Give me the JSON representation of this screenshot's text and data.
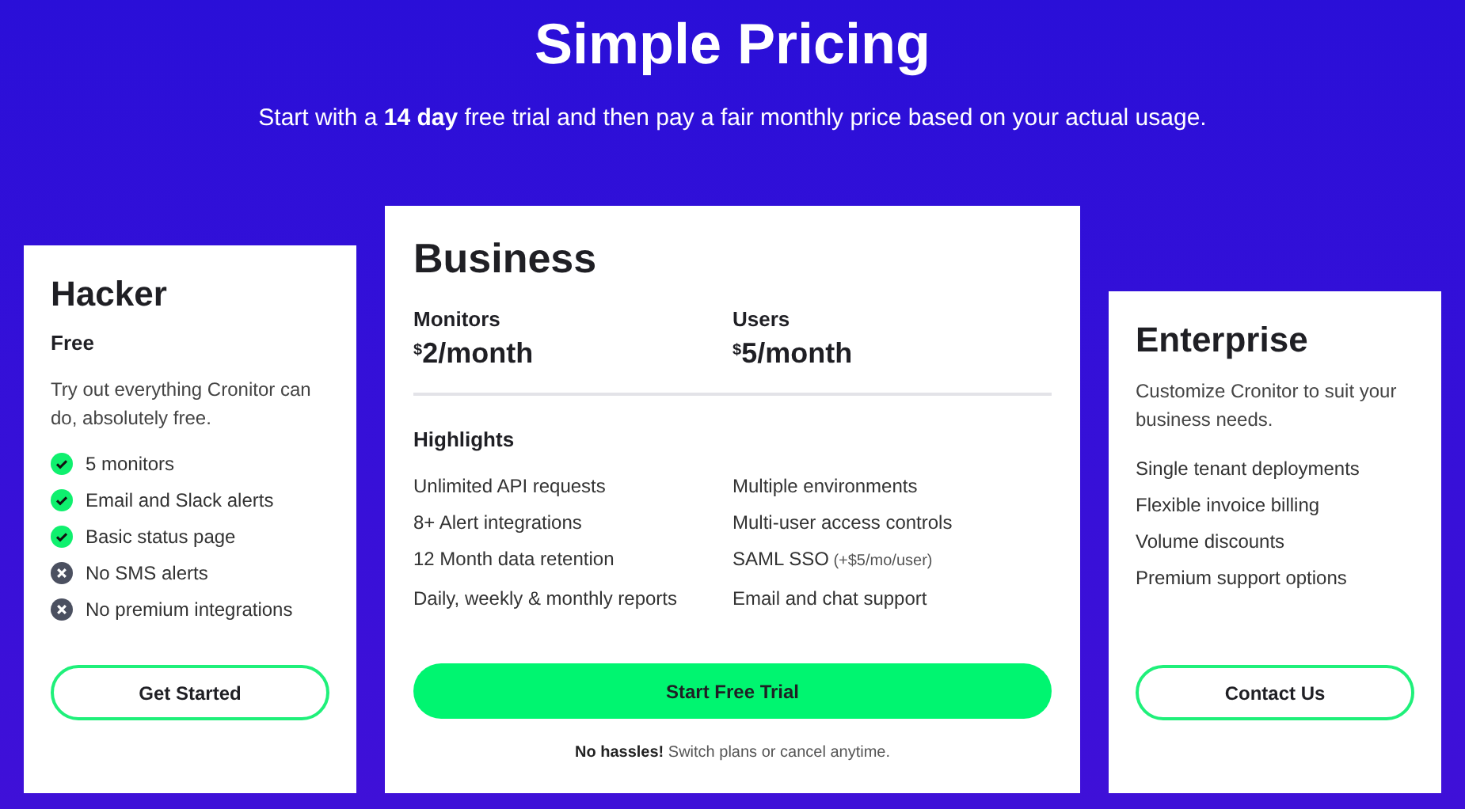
{
  "header": {
    "title": "Simple Pricing",
    "subtitle": "Start with a **14 day** free trial and then pay a fair monthly price based on your actual usage."
  },
  "plans": [
    {
      "name": "Hacker",
      "price": "Free",
      "description": "Try out everything Cronitor can do, absolutely free.",
      "features": [
        {
          "text": "5 monitors",
          "included": true
        },
        {
          "text": "Email and Slack alerts",
          "included": true
        },
        {
          "text": "Basic status page",
          "included": true
        },
        {
          "text": "No SMS alerts",
          "included": false
        },
        {
          "text": "No premium integrations",
          "included": false
        }
      ],
      "button": "Get Started"
    },
    {
      "name": "Business",
      "prices": [
        {
          "label": "Monitors",
          "currency": "$",
          "amount": "2/month"
        },
        {
          "label": "Users",
          "currency": "$",
          "amount": "5/month"
        }
      ],
      "highlights_title": "Highlights",
      "highlights": [
        {
          "text": "Unlimited API requests"
        },
        {
          "text": "Multiple environments"
        },
        {
          "text": "8+ Alert integrations"
        },
        {
          "text": "Multi-user access controls"
        },
        {
          "text": "12 Month data retention"
        },
        {
          "text": "SAML SSO",
          "note": "(+$5/mo/user)"
        },
        {
          "text": "Daily, weekly & monthly reports"
        },
        {
          "text": "Email and chat support"
        }
      ],
      "button": "Start Free Trial",
      "footnote": "**No hassles!** Switch plans or cancel anytime."
    },
    {
      "name": "Enterprise",
      "description": "Customize Cronitor to suit your business needs.",
      "features": [
        {
          "text": "Single tenant deployments"
        },
        {
          "text": "Flexible invoice billing"
        },
        {
          "text": "Volume discounts"
        },
        {
          "text": "Premium support options"
        }
      ],
      "button": "Contact Us"
    }
  ]
}
